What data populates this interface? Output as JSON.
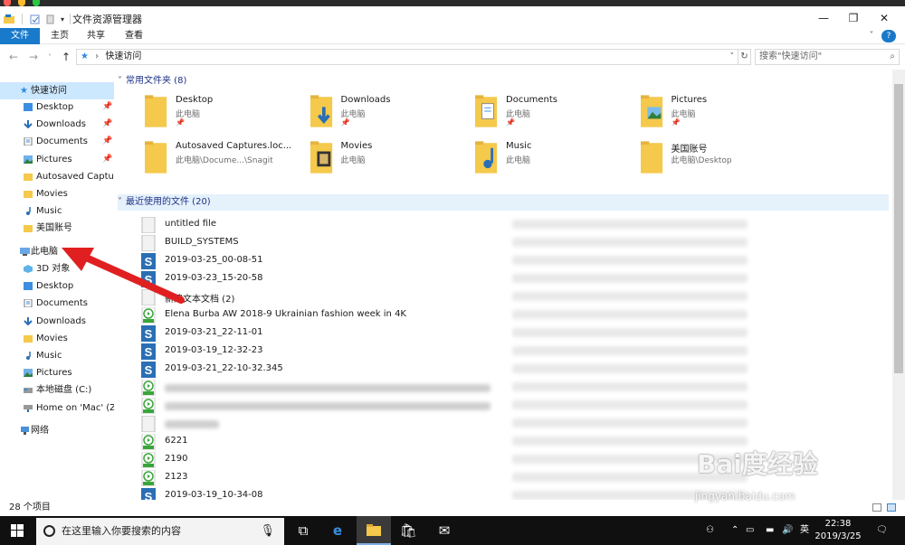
{
  "window": {
    "title": "文件资源管理器",
    "controls": {
      "minimize": "—",
      "maximize": "❐",
      "close": "✕"
    }
  },
  "ribbon": {
    "tabs": [
      "文件",
      "主页",
      "共享",
      "查看"
    ],
    "expand_glyph": "˅",
    "help_glyph": "?"
  },
  "address": {
    "path": "快速访问",
    "search_placeholder": "搜索\"快速访问\""
  },
  "nav": {
    "quick_access": "快速访问",
    "quick_items": [
      {
        "label": "Desktop",
        "icon": "folder-blue",
        "pinned": true
      },
      {
        "label": "Downloads",
        "icon": "download-arrow",
        "pinned": true
      },
      {
        "label": "Documents",
        "icon": "documents",
        "pinned": true
      },
      {
        "label": "Pictures",
        "icon": "pictures",
        "pinned": true
      },
      {
        "label": "Autosaved Captures",
        "icon": "folder-yellow",
        "pinned": false
      },
      {
        "label": "Movies",
        "icon": "folder-yellow",
        "pinned": false
      },
      {
        "label": "Music",
        "icon": "music-note",
        "pinned": false
      },
      {
        "label": "美国账号",
        "icon": "folder-yellow",
        "pinned": false
      }
    ],
    "this_pc": "此电脑",
    "pc_items": [
      {
        "label": "3D 对象",
        "icon": "cube"
      },
      {
        "label": "Desktop",
        "icon": "folder-blue"
      },
      {
        "label": "Documents",
        "icon": "documents"
      },
      {
        "label": "Downloads",
        "icon": "download-arrow"
      },
      {
        "label": "Movies",
        "icon": "folder-yellow"
      },
      {
        "label": "Music",
        "icon": "music-note"
      },
      {
        "label": "Pictures",
        "icon": "pictures"
      },
      {
        "label": "本地磁盘 (C:)",
        "icon": "drive"
      },
      {
        "label": "Home on 'Mac' (Z:)",
        "icon": "network-drive"
      }
    ],
    "network": "网络",
    "pin_glyph": "📌"
  },
  "frequent": {
    "header": "常用文件夹 (8)",
    "tiles": [
      {
        "name": "Desktop",
        "sub": "此电脑",
        "pinned": true,
        "overlay": "blank"
      },
      {
        "name": "Downloads",
        "sub": "此电脑",
        "pinned": true,
        "overlay": "arrow"
      },
      {
        "name": "Documents",
        "sub": "此电脑",
        "pinned": true,
        "overlay": "doc"
      },
      {
        "name": "Pictures",
        "sub": "此电脑",
        "pinned": true,
        "overlay": "pic"
      },
      {
        "name": "Autosaved Captures.loc...",
        "sub": "此电脑\\Docume...\\Snagit",
        "pinned": false,
        "overlay": "blank"
      },
      {
        "name": "Movies",
        "sub": "此电脑",
        "pinned": false,
        "overlay": "film"
      },
      {
        "name": "Music",
        "sub": "此电脑",
        "pinned": false,
        "overlay": "note"
      },
      {
        "name": "美国账号",
        "sub": "此电脑\\Desktop",
        "pinned": false,
        "overlay": "blank"
      }
    ]
  },
  "recent": {
    "header": "最近使用的文件 (20)",
    "files": [
      {
        "name": "untitled file",
        "icon": "blank"
      },
      {
        "name": "BUILD_SYSTEMS",
        "icon": "blank"
      },
      {
        "name": "2019-03-25_00-08-51",
        "icon": "snagit"
      },
      {
        "name": "2019-03-23_15-20-58",
        "icon": "snagit"
      },
      {
        "name": "新建文本文档 (2)",
        "icon": "blank"
      },
      {
        "name": "Elena Burba AW 2018-9 Ukrainian fashion week in 4K",
        "icon": "mp4"
      },
      {
        "name": "2019-03-21_22-11-01",
        "icon": "snagit"
      },
      {
        "name": "2019-03-19_12-32-23",
        "icon": "snagit"
      },
      {
        "name": "2019-03-21_22-10-32.345",
        "icon": "snagit"
      },
      {
        "name": "",
        "icon": "mp4"
      },
      {
        "name": "",
        "icon": "mp4"
      },
      {
        "name": "",
        "icon": "blank"
      },
      {
        "name": "6221",
        "icon": "mp4"
      },
      {
        "name": "2190",
        "icon": "mp4"
      },
      {
        "name": "2123",
        "icon": "mp4"
      },
      {
        "name": "2019-03-19_10-34-08",
        "icon": "snagit"
      }
    ]
  },
  "status": {
    "count": "28 个项目"
  },
  "taskbar": {
    "search_placeholder": "在这里输入你要搜索的内容",
    "ime": "英",
    "time": "22:38",
    "date": "2019/3/25",
    "watermark": "Bai度经验",
    "watermark_url": "jingyan.baidu.com"
  },
  "colors": {
    "accent": "#1979ca",
    "selection": "#cce8ff",
    "folder": "#f5c94b",
    "snagit": "#2a6fb5",
    "mp4": "#3aa53a",
    "arrow": "#e02020"
  }
}
